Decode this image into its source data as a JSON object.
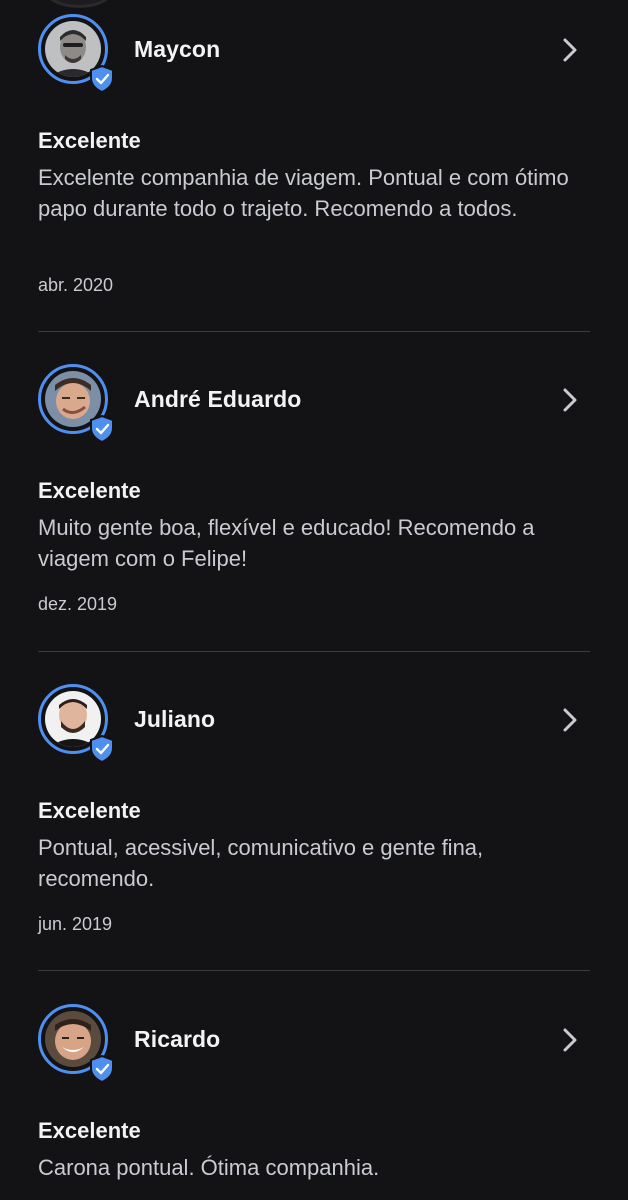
{
  "colors": {
    "background": "#131315",
    "accent": "#4f8ff0",
    "text_primary": "#f3f3f5",
    "text_secondary": "#c9cbd2",
    "divider": "#3a3a3f"
  },
  "icons": {
    "verified": "shield-check-icon",
    "chevron": "chevron-right-icon"
  },
  "reviews": [
    {
      "name": "Maycon",
      "rating": "Excelente",
      "comment": "Excelente companhia de viagem. Pontual e com ótimo papo durante todo o trajeto. Recomendo a todos.",
      "date": "abr. 2020"
    },
    {
      "name": "André Eduardo",
      "rating": "Excelente",
      "comment": "Muito gente boa, flexível e educado! Recomendo a viagem com o Felipe!",
      "date": "dez. 2019"
    },
    {
      "name": "Juliano",
      "rating": "Excelente",
      "comment": "Pontual, acessivel, comunicativo e gente fina, recomendo.",
      "date": "jun. 2019"
    },
    {
      "name": "Ricardo",
      "rating": "Excelente",
      "comment": "Carona pontual. Ótima companhia.",
      "date": ""
    }
  ]
}
